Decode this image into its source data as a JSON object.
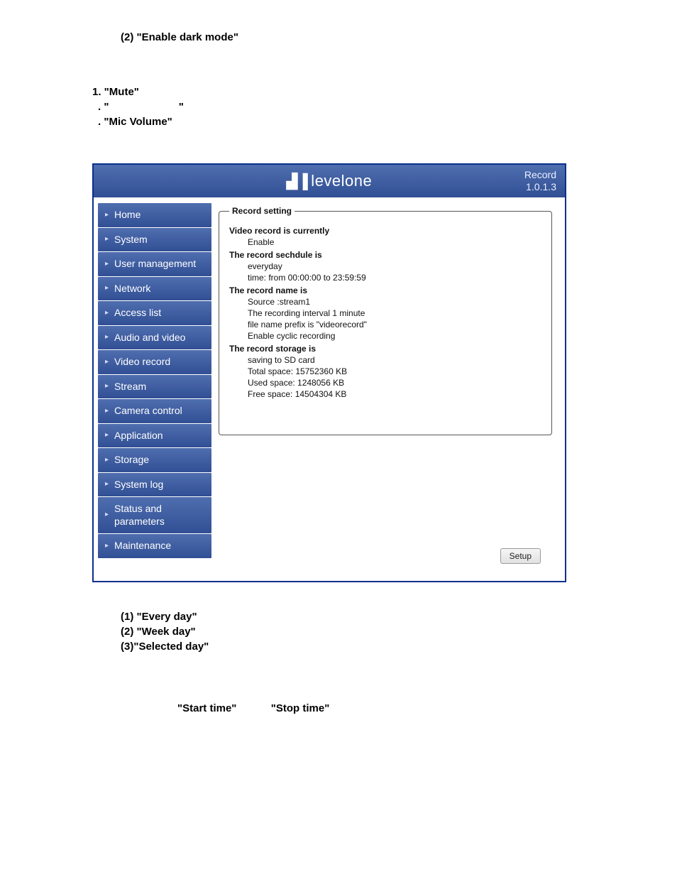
{
  "doc": {
    "line1": "(2) \"Enable dark mode\"",
    "line2": "1. \"Mute\"",
    "line3_open": ". \"",
    "line3_close": "\"",
    "line4": ". \"Mic Volume\"",
    "after1": "(1) \"Every day\"",
    "after2": "(2) \"Week day\"",
    "after3": "(3)\"Selected day\"",
    "start": "\"Start time\"",
    "stop": "\"Stop time\""
  },
  "app": {
    "brand": "levelone",
    "header_right_1": "Record",
    "header_right_2": "1.0.1.3",
    "sidebar": [
      "Home",
      "System",
      "User management",
      "Network",
      "Access list",
      "Audio and video",
      "Video record",
      "Stream",
      "Camera control",
      "Application",
      "Storage",
      "System log",
      "Status and parameters",
      "Maintenance"
    ],
    "record": {
      "legend": "Record setting",
      "l1": "Video record is currently",
      "v1": "Enable",
      "l2": "The record sechdule is",
      "v2a": "everyday",
      "v2b": "time: from 00:00:00 to 23:59:59",
      "l3": "The record name is",
      "v3a": "Source :stream1",
      "v3b": "The recording interval 1 minute",
      "v3c": "file name prefix is \"videorecord\"",
      "v3d": "Enable cyclic recording",
      "l4": "The record storage is",
      "v4a": "saving to SD card",
      "v4b": "Total space: 15752360 KB",
      "v4c": "Used space: 1248056 KB",
      "v4d": "Free space: 14504304 KB",
      "setup": "Setup"
    }
  }
}
